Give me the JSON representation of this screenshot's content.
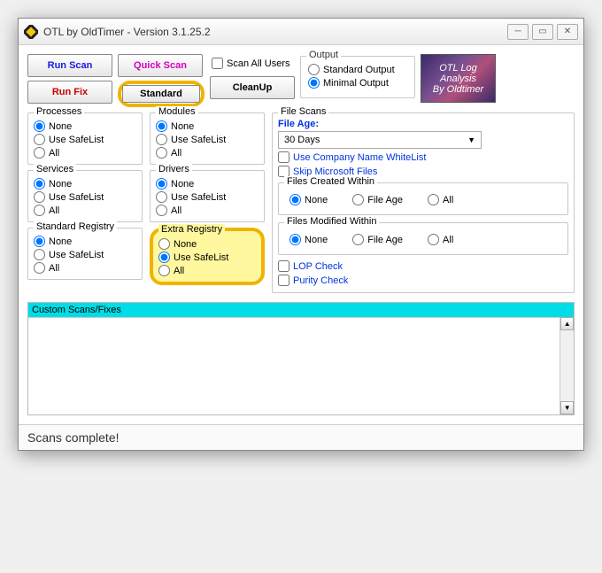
{
  "window": {
    "title": "OTL by OldTimer - Version 3.1.25.2"
  },
  "buttons": {
    "runscan": "Run Scan",
    "quickscan": "Quick Scan",
    "runfix": "Run Fix",
    "standard": "Standard",
    "cleanup": "CleanUp"
  },
  "scan_all_users": "Scan All Users",
  "output": {
    "legend": "Output",
    "standard": "Standard Output",
    "minimal": "Minimal Output",
    "selected": "minimal"
  },
  "logo": {
    "line1": "OTL Log Analysis",
    "line2": "By Oldtimer"
  },
  "groups": {
    "processes": {
      "legend": "Processes",
      "selected": "none"
    },
    "modules": {
      "legend": "Modules",
      "selected": "none"
    },
    "services": {
      "legend": "Services",
      "selected": "none"
    },
    "drivers": {
      "legend": "Drivers",
      "selected": "none"
    },
    "stdreg": {
      "legend": "Standard Registry",
      "selected": "none"
    },
    "extrareg": {
      "legend": "Extra Registry",
      "selected": "safelist"
    }
  },
  "opts": {
    "none": "None",
    "safelist": "Use SafeList",
    "all": "All"
  },
  "filescans": {
    "legend": "File Scans",
    "fileage_label": "File Age:",
    "fileage_value": "30 Days",
    "whitelist": "Use Company Name WhiteList",
    "skipms": "Skip Microsoft Files",
    "created": {
      "legend": "Files Created Within",
      "none": "None",
      "fileage": "File Age",
      "all": "All",
      "selected": "none"
    },
    "modified": {
      "legend": "Files Modified Within",
      "none": "None",
      "fileage": "File Age",
      "all": "All",
      "selected": "none"
    },
    "lop": "LOP Check",
    "purity": "Purity Check"
  },
  "custom": {
    "legend": "Custom Scans/Fixes",
    "value": ""
  },
  "statusbar": "Scans complete!"
}
